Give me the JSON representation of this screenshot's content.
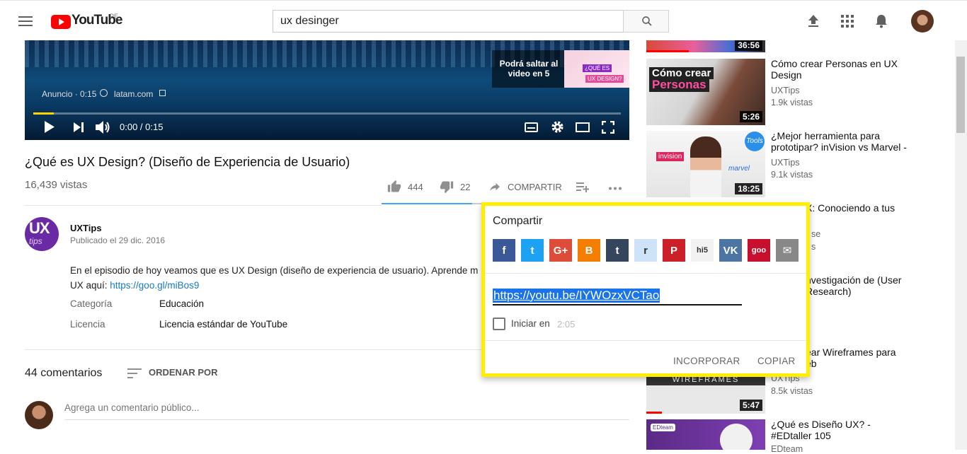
{
  "masthead": {
    "logo_text": "YouTube",
    "country_code": "PE",
    "search_value": "ux desinger"
  },
  "player": {
    "ad_label": "Anuncio · 0:15",
    "ad_link": "latam.com",
    "skip_text": "Podrá saltar al video en 5",
    "skip_thumb_tag1": "¿QUÉ ES",
    "skip_thumb_tag2": "UX DESIGN?",
    "time_display": "0:00 / 0:15",
    "progress_fraction": 0.035
  },
  "video": {
    "title": "¿Qué es UX Design? (Diseño de Experiencia de Usuario)",
    "views": "16,439 vistas",
    "likes": "444",
    "dislikes": "22",
    "share_label": "COMPARTIR",
    "like_ratio": 0.95
  },
  "channel": {
    "avatar_ux": "UX",
    "avatar_tips": "tips",
    "name": "UXTips",
    "published": "Publicado el 29 dic. 2016",
    "description_line1": "En el episodio de hoy veamos que es UX Design (diseño de experiencia de usuario). Aprende m",
    "description_line2_prefix": "UX aquí: ",
    "description_link": "https://goo.gl/miBos9",
    "category_label": "Categoría",
    "category_value": "Educación",
    "license_label": "Licencia",
    "license_value": "Licencia estándar de YouTube"
  },
  "comments": {
    "count": "44 comentarios",
    "sort_label": "ORDENAR POR",
    "placeholder": "Agrega un comentario público..."
  },
  "sidebar": {
    "items": [
      {
        "duration": "36:56",
        "title": "",
        "channel": "",
        "views": ""
      },
      {
        "duration": "5:26",
        "thumb_text1": "Cómo crear",
        "thumb_text2": "Personas",
        "title": "Cómo crear Personas en UX Design",
        "channel": "UXTips",
        "views": "1.9k vistas"
      },
      {
        "duration": "18:25",
        "thumb_text1": "invision",
        "thumb_text2": "marvel",
        "thumb_text3": "Tools",
        "title": "¿Mejor herramienta para prototipar? inVision vs Marvel -",
        "channel": "UXTips",
        "views": "9.1k vistas"
      },
      {
        "duration": "",
        "title": "X: Conociendo a tus",
        "channel": "se",
        "views": "s"
      },
      {
        "duration": "",
        "title": "nvestigación de (User Research)",
        "channel": "",
        "views": ""
      },
      {
        "duration": "5:47",
        "thumb_text1": "WIREFRAMES",
        "title": "ear Wireframes para eb",
        "channel": "UXTips",
        "views": "8.5k vistas"
      },
      {
        "duration": "",
        "thumb_text1": "EDteam",
        "title": "¿Qué es Diseño UX? - #EDtaller 105",
        "channel": "EDteam",
        "views": ""
      }
    ]
  },
  "share_dialog": {
    "title": "Compartir",
    "networks": [
      {
        "name": "Facebook",
        "glyph": "f",
        "color": "#3b5998"
      },
      {
        "name": "Twitter",
        "glyph": "t",
        "color": "#1da1f2"
      },
      {
        "name": "Google+",
        "glyph": "G+",
        "color": "#dd4b39"
      },
      {
        "name": "Blogger",
        "glyph": "B",
        "color": "#f57d00"
      },
      {
        "name": "Tumblr",
        "glyph": "t",
        "color": "#35465c"
      },
      {
        "name": "Reddit",
        "glyph": "r",
        "color": "#cee3f8"
      },
      {
        "name": "Pinterest",
        "glyph": "P",
        "color": "#cb2027"
      },
      {
        "name": "hi5",
        "glyph": "hi5",
        "color": "#f2f2f2"
      },
      {
        "name": "VK",
        "glyph": "VK",
        "color": "#4c75a3"
      },
      {
        "name": "goo",
        "glyph": "goo",
        "color": "#c8102e"
      },
      {
        "name": "Email",
        "glyph": "✉",
        "color": "#888888"
      }
    ],
    "url": "https://youtu.be/IYWOzxVCTao",
    "start_label": "Iniciar en",
    "start_time": "2:05",
    "embed_label": "INCORPORAR",
    "copy_label": "COPIAR",
    "highlight_color": "#ffee00"
  }
}
